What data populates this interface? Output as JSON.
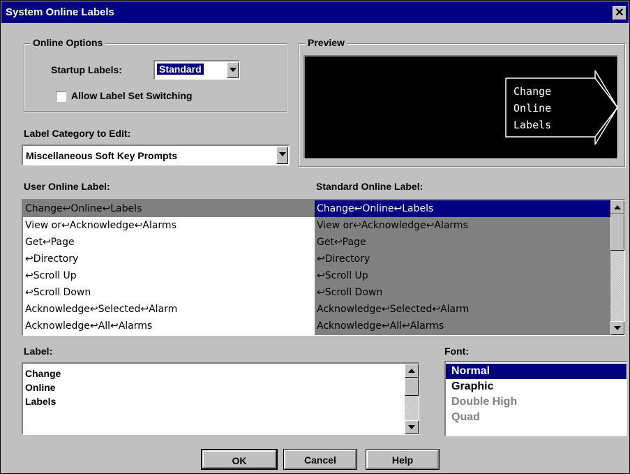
{
  "window": {
    "title": "System Online Labels"
  },
  "online_options": {
    "group_label": "Online Options",
    "startup_labels_label": "Startup Labels:",
    "startup_labels_value": "Standard",
    "allow_switching_label": "Allow Label Set Switching",
    "allow_switching_checked": false
  },
  "preview": {
    "group_label": "Preview",
    "text": "Change\nOnline\nLabels"
  },
  "category": {
    "label": "Label Category to Edit:",
    "value": "Miscellaneous Soft Key Prompts"
  },
  "user_label_header": "User Online Label:",
  "standard_label_header": "Standard Online Label:",
  "user_labels": [
    "Change↩Online↩Labels",
    "View or↩Acknowledge↩Alarms",
    "Get↩Page",
    "↩Directory",
    "↩Scroll Up",
    "↩Scroll Down",
    "Acknowledge↩Selected↩Alarm",
    "Acknowledge↩All↩Alarms"
  ],
  "standard_labels": [
    "Change↩Online↩Labels",
    "View or↩Acknowledge↩Alarms",
    "Get↩Page",
    "↩Directory",
    "↩Scroll Up",
    "↩Scroll Down",
    "Acknowledge↩Selected↩Alarm",
    "Acknowledge↩All↩Alarms"
  ],
  "selected_row": 0,
  "label_editor": {
    "label": "Label:",
    "text": "Change\nOnline\nLabels"
  },
  "font": {
    "label": "Font:",
    "options": [
      {
        "name": "Normal",
        "state": "selected"
      },
      {
        "name": "Graphic",
        "state": "enabled"
      },
      {
        "name": "Double High",
        "state": "disabled"
      },
      {
        "name": "Quad",
        "state": "disabled"
      }
    ]
  },
  "buttons": {
    "ok": "OK",
    "cancel": "Cancel",
    "help": "Help"
  },
  "colors": {
    "titlebar": "#000080",
    "face": "#c0c0c0",
    "selection": "#000080",
    "preview_bg": "#000000"
  }
}
